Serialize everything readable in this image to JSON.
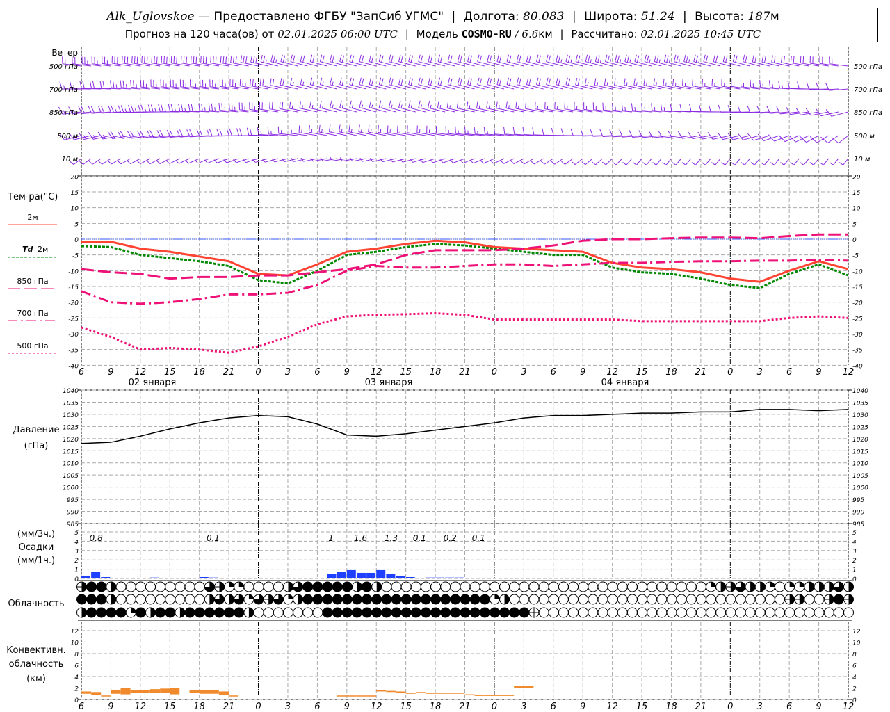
{
  "header": {
    "station": "Alk_Uglovskoe",
    "provider": "— Предоставлено ФГБУ \"ЗапСиб УГМС\"",
    "lon_label": "Долгота:",
    "lon": "80.083",
    "lat_label": "Широта:",
    "lat": "51.24",
    "alt_label": "Высота:",
    "alt": "187",
    "alt_unit": "м",
    "forecast_label": "Прогноз на 120 часа(ов) от",
    "init_time": "02.01.2025 06:00 UTC",
    "model_label": "Модель",
    "model": "COSMO-RU",
    "resolution": "/ 6.6",
    "resolution_unit": "км",
    "calc_label": "Рассчитано:",
    "calc_time": "02.01.2025 10:45 UTC",
    "sep": "|"
  },
  "labels": {
    "wind": "Ветер",
    "wind_levels": [
      "500 гПа",
      "700 гПа",
      "850 гПа",
      "500 м",
      "10 м"
    ],
    "temp_title": "Тем-ра(°C)",
    "legend_t2m": "2м",
    "legend_td": "Td",
    "legend_td2": "2м",
    "legend_850": "850 гПа",
    "legend_700": "700 гПа",
    "legend_500": "500 гПа",
    "pressure_title": "Давление",
    "pressure_unit": "(гПа)",
    "precip_unit3": "(мм/3ч.)",
    "precip_title": "Осадки",
    "precip_unit1": "(мм/1ч.)",
    "cloud_title": "Облачность",
    "conv_title1": "Конвективн.",
    "conv_title2": "облачность",
    "conv_unit": "(км)",
    "dates": [
      "02 января",
      "03 января",
      "04 января"
    ]
  },
  "colors": {
    "t2m": "#ff4433",
    "td": "#008800",
    "upper": "#ee1177",
    "wind": "#8a2be2",
    "precip": "#2040ff",
    "conv": "#f08a2c",
    "zero": "#3355ff"
  },
  "chart_data": {
    "type": "meteogram",
    "x_hours_from_start": "0..78 step 3 (start 02.01 06 UTC)",
    "x_tick_labels": [
      "6",
      "9",
      "12",
      "15",
      "18",
      "21",
      "0",
      "3",
      "6",
      "9",
      "12",
      "15",
      "18",
      "21",
      "0",
      "3",
      "6",
      "9",
      "12",
      "15",
      "18",
      "21",
      "0",
      "3",
      "6",
      "9",
      "12"
    ],
    "wind": {
      "levels": [
        "500 гПа",
        "700 гПа",
        "850 гПа",
        "500 м",
        "10 м"
      ],
      "direction_deg": [
        [
          285,
          285,
          290,
          290,
          290,
          290,
          295,
          300,
          300,
          300,
          300,
          300,
          300,
          300,
          300,
          300,
          300,
          300,
          300,
          300,
          300,
          300,
          300,
          300,
          295,
          290,
          285
        ],
        [
          270,
          275,
          280,
          285,
          285,
          285,
          290,
          295,
          300,
          300,
          300,
          300,
          300,
          300,
          300,
          300,
          300,
          300,
          295,
          295,
          295,
          290,
          290,
          285,
          280,
          270,
          260
        ],
        [
          255,
          260,
          265,
          270,
          275,
          280,
          285,
          290,
          295,
          300,
          300,
          300,
          300,
          295,
          295,
          295,
          290,
          290,
          285,
          280,
          280,
          275,
          270,
          265,
          260,
          250,
          240
        ],
        [
          240,
          245,
          250,
          255,
          260,
          265,
          270,
          280,
          290,
          295,
          295,
          290,
          290,
          285,
          280,
          280,
          275,
          270,
          265,
          260,
          255,
          250,
          245,
          240,
          230,
          220,
          210
        ],
        [
          210,
          215,
          220,
          220,
          225,
          230,
          235,
          240,
          245,
          250,
          245,
          240,
          235,
          230,
          225,
          220,
          215,
          210,
          205,
          200,
          200,
          200,
          200,
          200,
          200,
          200,
          200
        ]
      ],
      "speed_ms": [
        [
          20,
          25,
          30,
          30,
          30,
          30,
          30,
          25,
          20,
          20,
          20,
          20,
          20,
          20,
          20,
          20,
          20,
          25,
          25,
          25,
          25,
          25,
          20,
          20,
          20,
          20,
          20
        ],
        [
          15,
          20,
          25,
          25,
          25,
          25,
          25,
          20,
          15,
          15,
          20,
          20,
          20,
          20,
          20,
          20,
          20,
          20,
          15,
          15,
          15,
          15,
          15,
          15,
          15,
          10,
          10
        ],
        [
          15,
          20,
          25,
          25,
          25,
          25,
          25,
          20,
          15,
          15,
          15,
          15,
          15,
          15,
          15,
          15,
          15,
          15,
          15,
          15,
          15,
          10,
          10,
          10,
          10,
          10,
          10
        ],
        [
          15,
          15,
          20,
          20,
          20,
          20,
          20,
          15,
          15,
          15,
          15,
          15,
          15,
          15,
          15,
          10,
          10,
          10,
          10,
          10,
          10,
          10,
          10,
          10,
          10,
          10,
          10
        ],
        [
          5,
          5,
          5,
          5,
          5,
          5,
          5,
          5,
          5,
          5,
          5,
          5,
          5,
          5,
          5,
          5,
          5,
          5,
          5,
          5,
          5,
          5,
          5,
          5,
          5,
          5,
          5
        ]
      ]
    },
    "temperature": {
      "ylim": [
        -40,
        20
      ],
      "yticks": [
        20,
        15,
        10,
        5,
        0,
        -5,
        -10,
        -15,
        -20,
        -25,
        -30,
        -35,
        -40
      ],
      "series": [
        {
          "name": "2м",
          "style": "solid",
          "values": [
            -1,
            -0.8,
            -3,
            -4,
            -5.5,
            -7,
            -11,
            -11.5,
            -8,
            -4,
            -3,
            -1.5,
            -0.5,
            -1,
            -2.5,
            -3,
            -3.5,
            -4,
            -7.5,
            -9,
            -9.5,
            -10.5,
            -12.5,
            -13.5,
            -10,
            -7,
            -9.5
          ]
        },
        {
          "name": "Td 2м",
          "style": "dotted-green",
          "values": [
            -2.2,
            -2.5,
            -5,
            -6,
            -7,
            -8.5,
            -13,
            -14,
            -10,
            -5,
            -4,
            -2.5,
            -1.5,
            -2,
            -3,
            -4,
            -5,
            -5,
            -9,
            -10.5,
            -11,
            -12.5,
            -14.5,
            -15.5,
            -11,
            -8,
            -11.5
          ]
        },
        {
          "name": "850 гПа",
          "style": "long-dash",
          "values": [
            -9.5,
            -10.5,
            -11,
            -12.5,
            -12,
            -12,
            -11.5,
            -11.5,
            -10.5,
            -9.5,
            -8,
            -5,
            -3.5,
            -3.5,
            -3.5,
            -3,
            -2,
            -0.5,
            0,
            0,
            0.3,
            0.5,
            0.5,
            0.3,
            1,
            1.5,
            1.5
          ]
        },
        {
          "name": "700 гПа",
          "style": "dash-dot",
          "values": [
            -16.5,
            -20,
            -20.5,
            -20,
            -19,
            -17.5,
            -17.5,
            -17,
            -14.5,
            -10,
            -8.5,
            -9,
            -9,
            -8.5,
            -8,
            -8,
            -8.5,
            -8,
            -7.5,
            -7.5,
            -7.2,
            -7,
            -7,
            -6.8,
            -6.8,
            -6.5,
            -6.8
          ]
        },
        {
          "name": "500 гПа",
          "style": "dotted",
          "values": [
            -28,
            -31,
            -35,
            -34.5,
            -35,
            -36,
            -34,
            -31,
            -27,
            -24.5,
            -24,
            -23.8,
            -23.5,
            -24,
            -25.5,
            -25.5,
            -25.5,
            -25.5,
            -25.5,
            -26,
            -26,
            -26,
            -26,
            -26,
            -25,
            -24.5,
            -25
          ]
        }
      ]
    },
    "pressure": {
      "ylim": [
        985,
        1040
      ],
      "yticks": [
        1040,
        1035,
        1030,
        1025,
        1020,
        1015,
        1010,
        1005,
        1000,
        995,
        990,
        985
      ],
      "values": [
        1018,
        1018.5,
        1021,
        1024,
        1026.5,
        1028.5,
        1029.5,
        1029,
        1026,
        1021.5,
        1021,
        1022,
        1023.5,
        1025,
        1026.5,
        1028.5,
        1029.5,
        1029.5,
        1030,
        1030.5,
        1030.5,
        1031,
        1031,
        1032,
        1032,
        1031.5,
        1032
      ]
    },
    "precipitation": {
      "ylim": [
        0,
        5
      ],
      "yticks": [
        5,
        4,
        3,
        2,
        1,
        0
      ],
      "hourly_mm": [
        0.3,
        0.7,
        0.15,
        0,
        0,
        0,
        0,
        0.1,
        0,
        0,
        0.05,
        0,
        0.15,
        0.1,
        0,
        0,
        0,
        0,
        0,
        0,
        0,
        0,
        0,
        0,
        0.05,
        0.5,
        0.7,
        0.9,
        0.6,
        0.6,
        0.9,
        0.5,
        0.3,
        0.15,
        0.05,
        0.1,
        0.1,
        0.1,
        0.1,
        0.05,
        0,
        0,
        0,
        0,
        0,
        0,
        0,
        0,
        0,
        0,
        0,
        0,
        0,
        0,
        0,
        0,
        0,
        0,
        0,
        0,
        0,
        0,
        0,
        0,
        0,
        0,
        0,
        0,
        0,
        0,
        0,
        0,
        0,
        0,
        0,
        0,
        0,
        0,
        0
      ],
      "totals_3h": [
        {
          "hour": 1.5,
          "label": "0.8"
        },
        {
          "hour": 13.4,
          "label": "0.1"
        },
        {
          "hour": 25.4,
          "label": "1"
        },
        {
          "hour": 28.4,
          "label": "1.6"
        },
        {
          "hour": 31.5,
          "label": "1.3"
        },
        {
          "hour": 34.4,
          "label": "0.1"
        },
        {
          "hour": 37.5,
          "label": "0.2"
        },
        {
          "hour": 40.4,
          "label": "0.1"
        }
      ]
    },
    "cloudiness": {
      "legend": "0=clear q=quarter v=half h=half-horizontal t=three-quarter f=overcast c=cross",
      "rows": [
        "hffv000000000thqq0000vtfffffvfv000000000000000000000000000000000qvhtvvq0qqvvvtv",
        "fffv000000000vtvtqthtqvfffffffffffffffffffqv0000000000000000000000000000hh00hfh",
        "vffffqfvffvffffffv0000000fffffffffffffffffffffc00000000000000000000000000000000"
      ]
    },
    "convective": {
      "ylim": [
        0,
        13
      ],
      "yticks": [
        12,
        10,
        8,
        6,
        4,
        2,
        0
      ],
      "bars_km": [
        [
          0,
          1.0,
          1.4
        ],
        [
          1,
          0.8,
          1.3
        ],
        [
          2,
          0.6,
          0.7
        ],
        [
          3,
          1.0,
          1.7
        ],
        [
          4,
          0.9,
          2.0
        ],
        [
          5,
          1.2,
          1.6
        ],
        [
          6,
          1.2,
          1.6
        ],
        [
          7,
          1.2,
          1.8
        ],
        [
          8,
          1.1,
          1.9
        ],
        [
          9,
          0.9,
          2.0
        ],
        [
          11,
          1.2,
          1.6
        ],
        [
          12,
          1.0,
          1.6
        ],
        [
          13,
          1.0,
          1.6
        ],
        [
          14,
          0.8,
          1.4
        ],
        [
          15,
          0.6,
          0.7
        ],
        [
          26,
          0.6,
          0.7
        ],
        [
          27,
          0.6,
          0.7
        ],
        [
          28,
          0.6,
          0.7
        ],
        [
          29,
          0.6,
          0.7
        ],
        [
          30,
          1.4,
          1.7
        ],
        [
          31,
          1.3,
          1.5
        ],
        [
          32,
          1.2,
          1.4
        ],
        [
          33,
          1.0,
          1.2
        ],
        [
          34,
          1.1,
          1.3
        ],
        [
          35,
          1.0,
          1.2
        ],
        [
          36,
          1.0,
          1.2
        ],
        [
          37,
          1.0,
          1.2
        ],
        [
          38,
          1.0,
          1.2
        ],
        [
          39,
          0.8,
          0.9
        ],
        [
          40,
          0.7,
          0.8
        ],
        [
          41,
          0.7,
          0.8
        ],
        [
          42,
          0.7,
          0.8
        ],
        [
          43,
          0.7,
          0.8
        ],
        [
          44,
          2.0,
          2.3
        ],
        [
          45,
          2.0,
          2.3
        ]
      ]
    }
  }
}
